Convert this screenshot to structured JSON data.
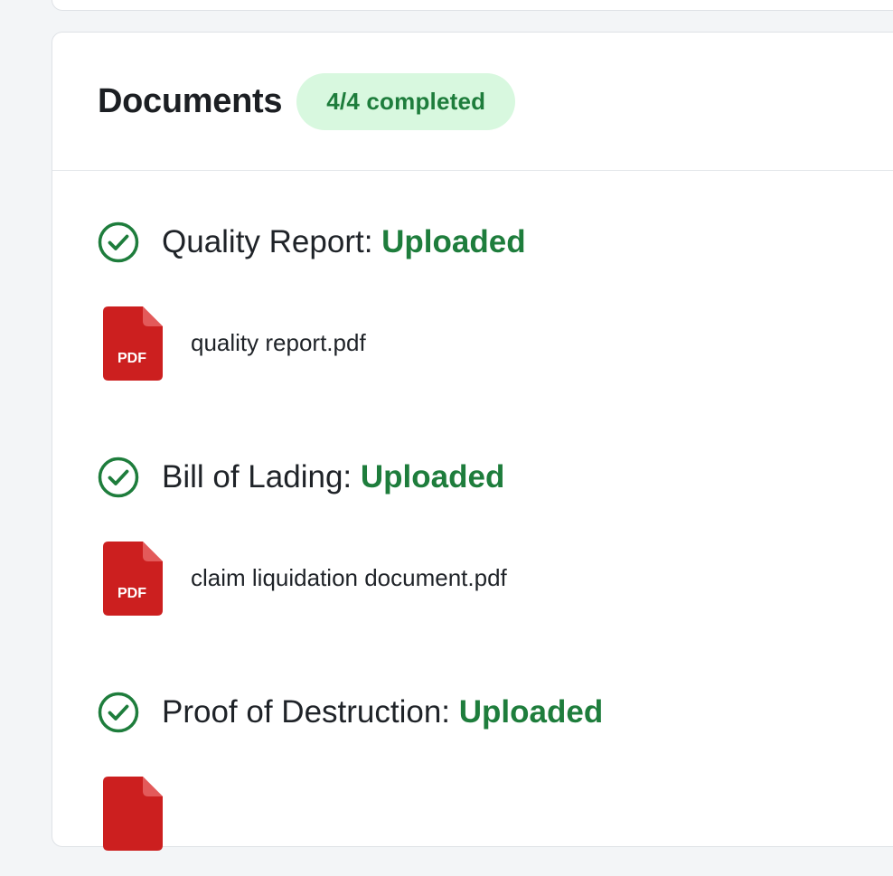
{
  "documents": {
    "title": "Documents",
    "badge": "4/4 completed",
    "groups": [
      {
        "label": "Quality Report: ",
        "status": "Uploaded",
        "file": "quality report.pdf",
        "file_type": "PDF"
      },
      {
        "label": "Bill of Lading: ",
        "status": "Uploaded",
        "file": "claim liquidation document.pdf",
        "file_type": "PDF"
      },
      {
        "label": "Proof of Destruction: ",
        "status": "Uploaded",
        "file": "",
        "file_type": "PDF"
      }
    ]
  },
  "icons": {
    "check": "check-circle-icon",
    "pdf": "pdf-file-icon"
  },
  "colors": {
    "success": "#1e7d3c",
    "badge_bg": "#d8f8df",
    "pdf_red": "#cc1f1f",
    "pdf_fold": "#e35a5a"
  }
}
